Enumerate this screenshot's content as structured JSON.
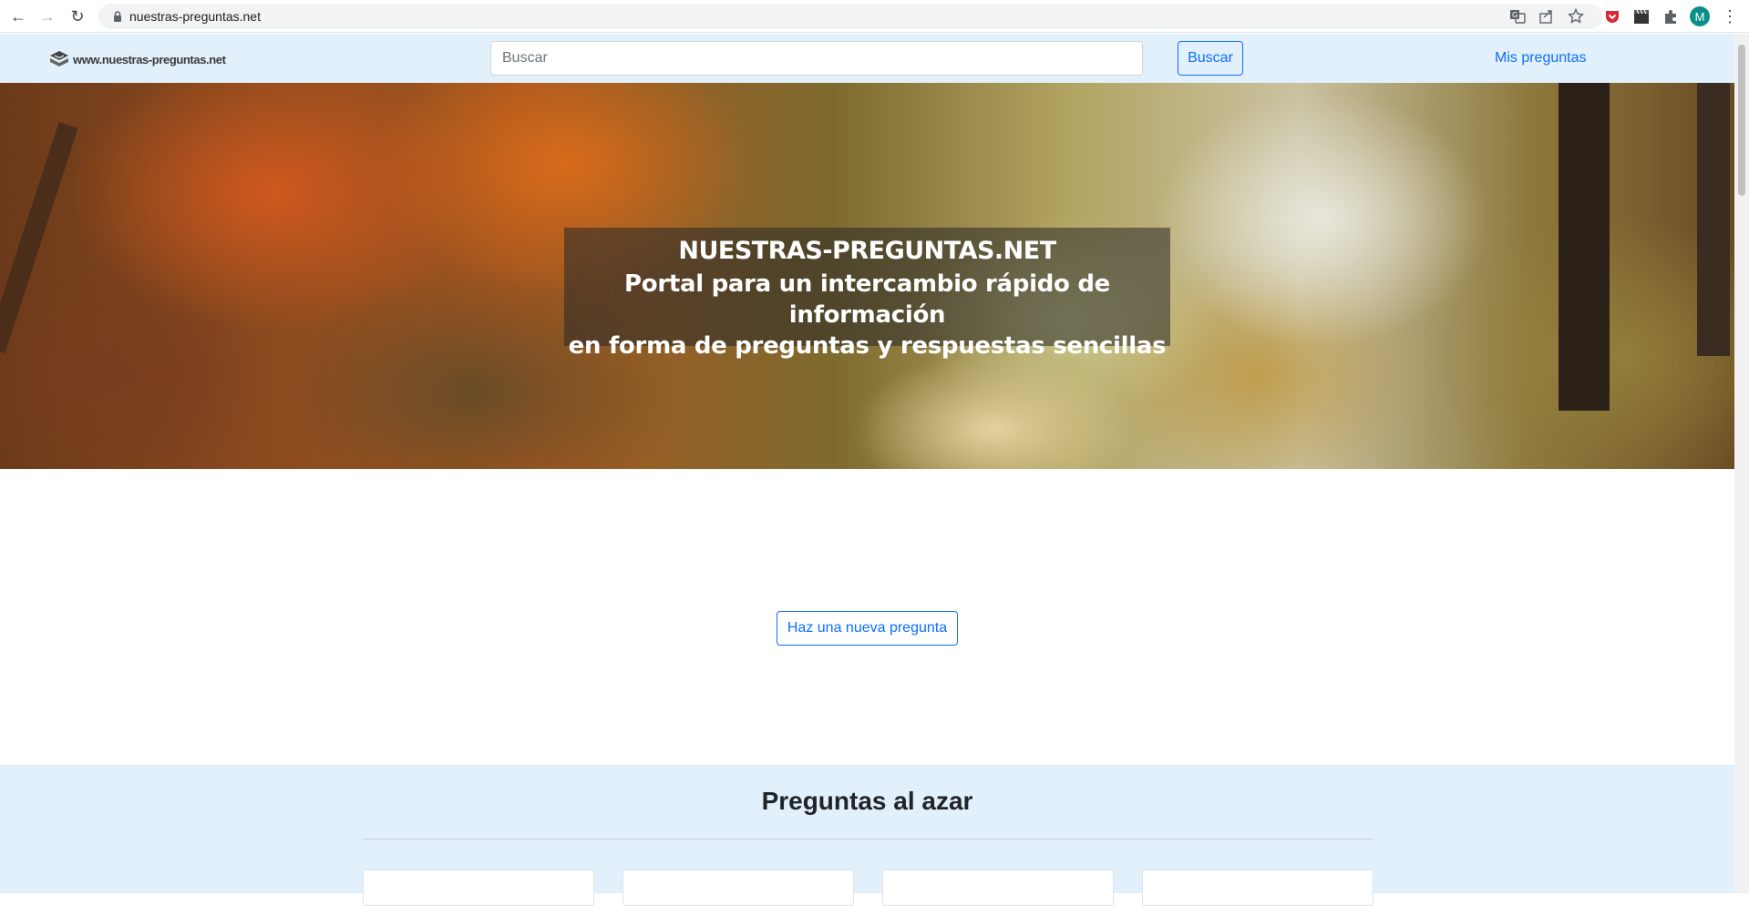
{
  "browser": {
    "url": "nuestras-preguntas.net",
    "back_icon": "←",
    "forward_icon": "→",
    "reload_icon": "↻",
    "profile_initial": "M",
    "menu_icon": "⋮"
  },
  "header": {
    "logo_text": "www.nuestras-preguntas.net",
    "search_placeholder": "Buscar",
    "search_button": "Buscar",
    "my_questions_link": "Mis preguntas"
  },
  "hero": {
    "title": "NUESTRAS-PREGUNTAS.NET",
    "subtitle_line1": "Portal para un intercambio rápido de información",
    "subtitle_line2": "en forma de preguntas y respuestas sencillas"
  },
  "main": {
    "new_question_button": "Haz una nueva pregunta"
  },
  "random": {
    "title": "Preguntas al azar"
  },
  "colors": {
    "accent": "#0d6efd",
    "header_bg": "#e2f0fb"
  }
}
